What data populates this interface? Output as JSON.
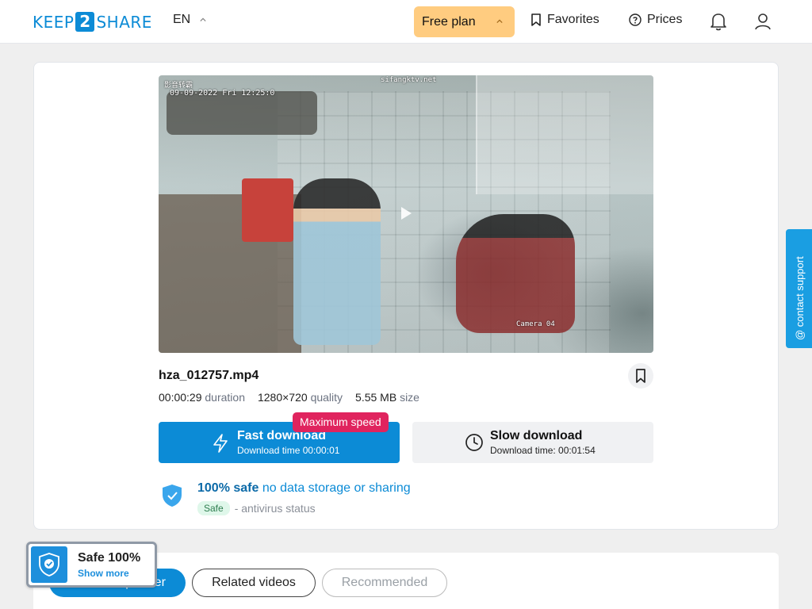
{
  "header": {
    "logo_left": "KEEP",
    "logo_mid": "2",
    "logo_right": "SHARE",
    "language": "EN",
    "plan_label": "Free plan",
    "favorites_label": "Favorites",
    "prices_label": "Prices"
  },
  "video": {
    "overlay_channel": "影音转霸",
    "overlay_datetime": "09-09-2022 Fri 12:25:0",
    "overlay_site": "sifangktv.net",
    "overlay_camera": "Camera 04"
  },
  "file": {
    "name": "hza_012757.mp4",
    "duration_value": "00:00:29",
    "duration_label": "duration",
    "quality_value": "1280×720",
    "quality_label": "quality",
    "size_value": "5.55 MB",
    "size_label": "size"
  },
  "download": {
    "badge": "Maximum speed",
    "fast_title": "Fast download",
    "fast_time": "Download time 00:00:01",
    "slow_title": "Slow download",
    "slow_time": "Download time: 00:01:54"
  },
  "safety": {
    "headline_strong": "100% safe",
    "headline_rest": "no data storage or sharing",
    "status_pill": "Safe",
    "status_text": "- antivirus status"
  },
  "support": {
    "label": "@ contact support"
  },
  "tabs": [
    {
      "label": "From this partner"
    },
    {
      "label": "Related videos"
    },
    {
      "label": "Recommended"
    }
  ],
  "safe_widget": {
    "title": "Safe 100%",
    "link": "Show more"
  },
  "colors": {
    "brand_blue": "#0c8bd6",
    "plan_orange": "#ffcc80",
    "badge_pink": "#e0245e"
  }
}
